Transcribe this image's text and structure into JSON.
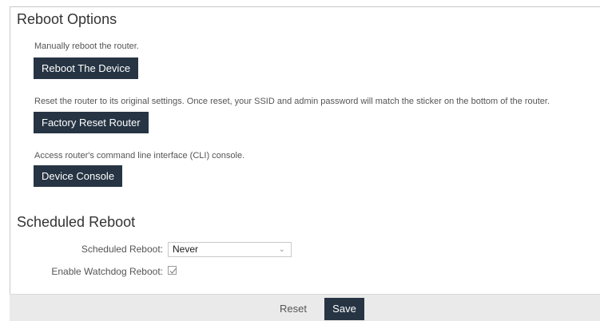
{
  "reboot_options": {
    "title": "Reboot Options",
    "reboot_desc": "Manually reboot the router.",
    "reboot_button": "Reboot The Device",
    "reset_desc": "Reset the router to its original settings. Once reset, your SSID and admin password will match the sticker on the bottom of the router.",
    "reset_button": "Factory Reset Router",
    "console_desc": "Access router's command line interface (CLI) console.",
    "console_button": "Device Console"
  },
  "scheduled_reboot": {
    "title": "Scheduled Reboot",
    "schedule_label": "Scheduled Reboot:",
    "schedule_value": "Never",
    "watchdog_label": "Enable Watchdog Reboot:",
    "watchdog_checked": true
  },
  "footer": {
    "reset_label": "Reset",
    "save_label": "Save"
  },
  "colors": {
    "button_dark": "#263443",
    "footer_bg": "#eaeaea"
  }
}
